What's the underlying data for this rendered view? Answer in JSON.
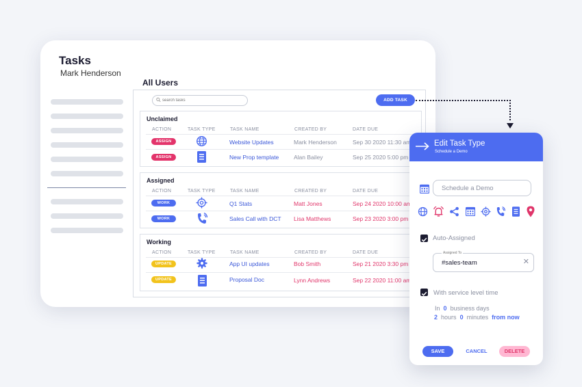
{
  "window": {
    "title": "Tasks",
    "subtitle": "Mark Henderson",
    "heading": "All Users"
  },
  "search": {
    "placeholder": "search tasks"
  },
  "add_task_label": "ADD TASK",
  "columns": [
    "ACTION",
    "TASK TYPE",
    "TASK NAME",
    "CREATED BY",
    "DATE DUE"
  ],
  "sections": [
    {
      "title": "Unclaimed",
      "rows": [
        {
          "action": "ASSIGN",
          "icon": "globe-icon",
          "name": "Website Updates",
          "created_by": "Mark Henderson",
          "due": "Sep 30 2020 11:30 am"
        },
        {
          "action": "ASSIGN",
          "icon": "document-icon",
          "name": "New Prop template",
          "created_by": "Alan Bailey",
          "due": "Sep 25 2020 5:00 pm"
        }
      ]
    },
    {
      "title": "Assigned",
      "rows": [
        {
          "action": "WORK",
          "icon": "target-icon",
          "name": "Q1 Stats",
          "created_by": "Matt Jones",
          "due": "Sep 24 2020 10:00 am"
        },
        {
          "action": "WORK",
          "icon": "phone-icon",
          "name": "Sales Call with DCT",
          "created_by": "Lisa Matthews",
          "due": "Sep 23 2020 3:00 pm"
        }
      ]
    },
    {
      "title": "Working",
      "rows": [
        {
          "action": "UPDATE",
          "icon": "gear-icon",
          "name": "App UI updates",
          "created_by": "Bob Smith",
          "due": "Sep 21 2020 3:30 pm"
        },
        {
          "action": "UPDATE",
          "icon": "document-icon",
          "name": "Proposal Doc",
          "created_by": "Lynn Andrews",
          "due": "Sep 22 2020 11:00 am"
        }
      ]
    }
  ],
  "colors": {
    "accent": "#4d6cf0",
    "assign": "#e3346b",
    "work": "#4d6cf0",
    "update": "#f2c31c",
    "overdue": "#e0356a",
    "muted": "#8a8fa0"
  },
  "edit": {
    "title": "Edit Task Type",
    "subtitle": "Schedule a Demo",
    "name_value": "Schedule a Demo",
    "type_icons": [
      "globe-icon",
      "alarm-icon",
      "share-icon",
      "calendar-icon",
      "target-icon",
      "phone-icon",
      "document-icon",
      "location-pin-icon"
    ],
    "auto_assigned_label": "Auto-Assigned",
    "assigned_to_label": "Assigned To",
    "assigned_to_value": "#sales-team",
    "sla_label": "With service level time",
    "sla_in": "In",
    "sla_days": "0",
    "sla_days_label": "business days",
    "sla_hours": "2",
    "sla_hours_label": "hours",
    "sla_minutes": "0",
    "sla_minutes_label": "minutes",
    "sla_from": "from now",
    "save_label": "SAVE",
    "cancel_label": "CANCEL",
    "delete_label": "DELETE"
  }
}
